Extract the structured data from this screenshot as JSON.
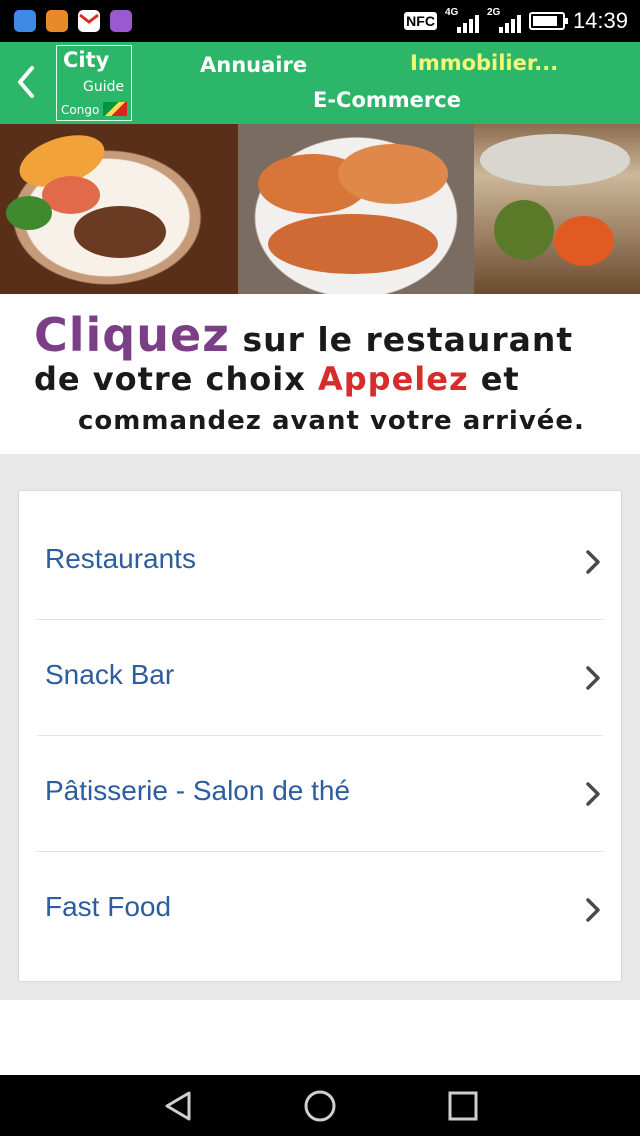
{
  "status_bar": {
    "time": "14:39",
    "nfc_label": "NFC",
    "network_1": "4G",
    "network_2": "2G",
    "app_icons": [
      "dial-app-icon",
      "photo-app-icon",
      "gmail-icon",
      "gallery-app-icon"
    ]
  },
  "app_bar": {
    "logo_city": "City",
    "logo_guide": "Guide",
    "logo_congo": "Congo",
    "nav_annuaire": "Annuaire",
    "nav_immobilier": "Immobilier...",
    "nav_ecommerce": "E-Commerce",
    "color": "#2bb66a"
  },
  "promo": {
    "cliquez": "Cliquez",
    "line1_rest": " sur le restaurant",
    "line2_start": "de votre choix ",
    "appelez": "Appelez",
    "line2_end": " et",
    "line3": "commandez avant votre arrivée."
  },
  "categories": [
    {
      "label": "Restaurants"
    },
    {
      "label": "Snack Bar"
    },
    {
      "label": "Pâtisserie - Salon de thé"
    },
    {
      "label": "Fast Food"
    }
  ]
}
